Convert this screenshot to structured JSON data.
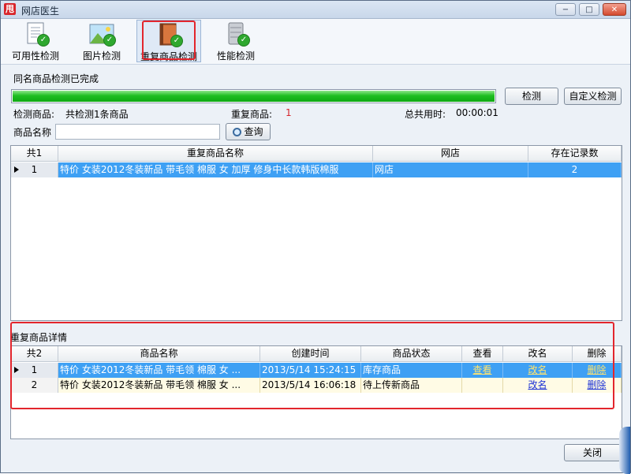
{
  "window": {
    "title": "网店医生",
    "app_icon": "甩"
  },
  "controls": {
    "minimize": "−",
    "maximize": "□",
    "close": "✕"
  },
  "toolbar": {
    "tools": [
      {
        "label": "可用性检测",
        "icon": "document-check-icon"
      },
      {
        "label": "图片检测",
        "icon": "image-check-icon"
      },
      {
        "label": "重复商品检测",
        "icon": "book-check-icon"
      },
      {
        "label": "性能检测",
        "icon": "server-check-icon"
      }
    ]
  },
  "status": {
    "text": "同名商品检测已完成",
    "progress_percent": 100,
    "progress_color": "#1fbe21"
  },
  "buttons": {
    "detect": "检测",
    "custom_detect": "自定义检测",
    "search": "查询",
    "close": "关闭"
  },
  "info": {
    "detected_label": "检测商品:",
    "detected_value": "共检测1条商品",
    "dup_label": "重复商品:",
    "dup_value": "1",
    "time_label": "总共用时:",
    "time_value": "00:00:01"
  },
  "search": {
    "label": "商品名称",
    "value": "",
    "placeholder": ""
  },
  "dup_grid": {
    "headers": [
      "共1",
      "重复商品名称",
      "网店",
      "存在记录数"
    ],
    "rows": [
      {
        "index": "1",
        "name": "特价 女装2012冬装新品 带毛领 棉服 女 加厚 修身中长款韩版棉服",
        "shop": "网店",
        "count": "2"
      }
    ]
  },
  "detail": {
    "label": "重复商品详情",
    "headers": [
      "共2",
      "商品名称",
      "创建时间",
      "商品状态",
      "查看",
      "改名",
      "删除"
    ],
    "rows": [
      {
        "index": "1",
        "name": "特价 女装2012冬装新品 带毛领 棉服 女 ...",
        "created": "2013/5/14 15:24:15",
        "status": "库存商品",
        "view": "查看",
        "rename": "改名",
        "delete": "删除"
      },
      {
        "index": "2",
        "name": "特价 女装2012冬装新品 带毛领 棉服 女 ...",
        "created": "2013/5/14 16:06:18",
        "status": "待上传新商品",
        "view": "",
        "rename": "改名",
        "delete": "删除"
      }
    ]
  },
  "colors": {
    "selection": "#3ea0f4",
    "highlight_box": "#e3262d",
    "row_bg": "#fffbe5"
  }
}
